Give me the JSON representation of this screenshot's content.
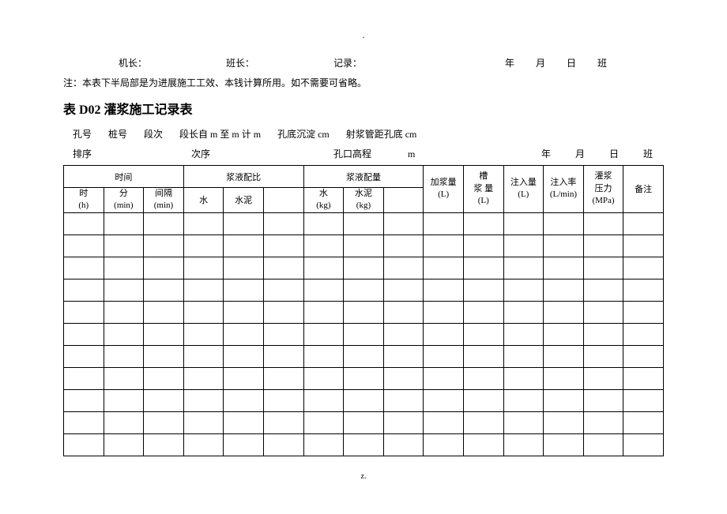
{
  "topDot": ".",
  "line1": {
    "captain": "机长：",
    "shiftLeader": "班长：",
    "recorder": "记录：",
    "year": "年",
    "month": "月",
    "day": "日",
    "shift": "班"
  },
  "note": "注：本表下半局部是为进展施工工效、本钱计算所用。如不需要可省略。",
  "title": "表 D02 灌浆施工记录表",
  "meta1": {
    "holeNo": "孔号",
    "pileNo": "桩号",
    "segNo": "段次",
    "segLen": "段长自 m 至 m 计 m",
    "holeBottom": "孔底沉淀 cm",
    "shotDist": "射浆管距孔底 cm"
  },
  "meta2": {
    "order": "排序",
    "seq": "次序",
    "holeElev": "孔口高程",
    "m": "m",
    "year": "年",
    "month": "月",
    "day": "日",
    "shift": "班"
  },
  "headers": {
    "time": "时间",
    "timeH": "时",
    "timeHUnit": "(h)",
    "timeM": "分",
    "timeMUnit": "(min)",
    "interval": "间隔",
    "intervalUnit": "(min)",
    "mixRatio": "浆液配比",
    "water": "水",
    "cement": "水泥",
    "mixAmount": "浆液配量",
    "waterKg": "水",
    "waterKgUnit": "(kg)",
    "cementKg": "水泥",
    "cementKgUnit": "(kg)",
    "addAmount": "加浆量",
    "addAmountUnit": "(L)",
    "tankAmount": "槽",
    "tankAmount2": "浆 量",
    "tankAmountUnit": "(L)",
    "injAmount": "注入量",
    "injAmountUnit": "(L)",
    "injRate": "注入率",
    "injRateUnit": "(L/min)",
    "pressure": "灌浆",
    "pressure2": "压力",
    "pressureUnit": "(MPa)",
    "remark": "备注"
  },
  "footerDot": "z."
}
